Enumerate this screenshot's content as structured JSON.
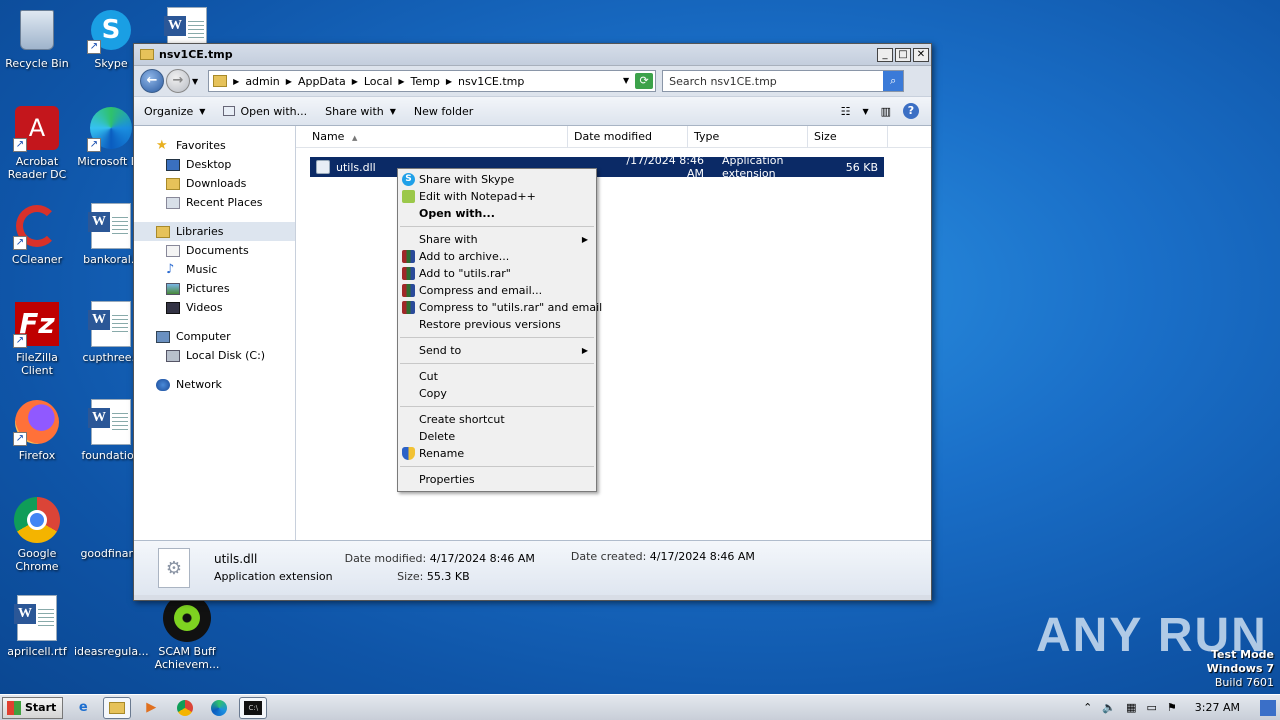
{
  "desktop": {
    "icons": [
      {
        "label": "Recycle Bin"
      },
      {
        "label": "Skype"
      },
      {
        "label": "Acrobat Reader DC"
      },
      {
        "label": "Microsoft Ed"
      },
      {
        "label": "CCleaner"
      },
      {
        "label": "bankoral.r"
      },
      {
        "label": "FileZilla Client"
      },
      {
        "label": "cupthree.r"
      },
      {
        "label": "Firefox"
      },
      {
        "label": "foundation"
      },
      {
        "label": "Google Chrome"
      },
      {
        "label": "goodfinanc"
      },
      {
        "label": "aprilcell.rtf"
      },
      {
        "label": "ideasregula..."
      },
      {
        "label": "SCAM Buff Achievem..."
      }
    ]
  },
  "window": {
    "title": "nsv1CE.tmp",
    "breadcrumb": [
      "admin",
      "AppData",
      "Local",
      "Temp",
      "nsv1CE.tmp"
    ],
    "search_placeholder": "Search nsv1CE.tmp",
    "toolbar": {
      "organize": "Organize",
      "open_with": "Open with...",
      "share_with": "Share with",
      "new_folder": "New folder"
    },
    "nav": {
      "favorites": "Favorites",
      "desktop": "Desktop",
      "downloads": "Downloads",
      "recent": "Recent Places",
      "libraries": "Libraries",
      "documents": "Documents",
      "music": "Music",
      "pictures": "Pictures",
      "videos": "Videos",
      "computer": "Computer",
      "local_disk": "Local Disk (C:)",
      "network": "Network"
    },
    "columns": [
      "Name",
      "Date modified",
      "Type",
      "Size"
    ],
    "file": {
      "name": "utils.dll",
      "date": "4/17/2024 8:46 AM",
      "date_visible": "/17/2024 8:46 AM",
      "type": "Application extension",
      "size": "56 KB"
    },
    "details": {
      "name": "utils.dll",
      "type": "Application extension",
      "date_modified_label": "Date modified:",
      "date_modified": "4/17/2024 8:46 AM",
      "size_label": "Size:",
      "size": "55.3 KB",
      "date_created_label": "Date created:",
      "date_created": "4/17/2024 8:46 AM"
    }
  },
  "context_menu": {
    "share_skype": "Share with Skype",
    "edit_npp": "Edit with Notepad++",
    "open_with": "Open with...",
    "share_with": "Share with",
    "add_archive": "Add to archive...",
    "add_rar": "Add to \"utils.rar\"",
    "compress_email": "Compress and email...",
    "compress_rar_email": "Compress to \"utils.rar\" and email",
    "restore": "Restore previous versions",
    "send_to": "Send to",
    "cut": "Cut",
    "copy": "Copy",
    "create_shortcut": "Create shortcut",
    "delete": "Delete",
    "rename": "Rename",
    "properties": "Properties"
  },
  "taskbar": {
    "start": "Start",
    "clock": "3:27 AM"
  },
  "watermark": {
    "text": "ANY RUN",
    "mode": "Test Mode",
    "os": "Windows 7",
    "build": "Build 7601"
  }
}
